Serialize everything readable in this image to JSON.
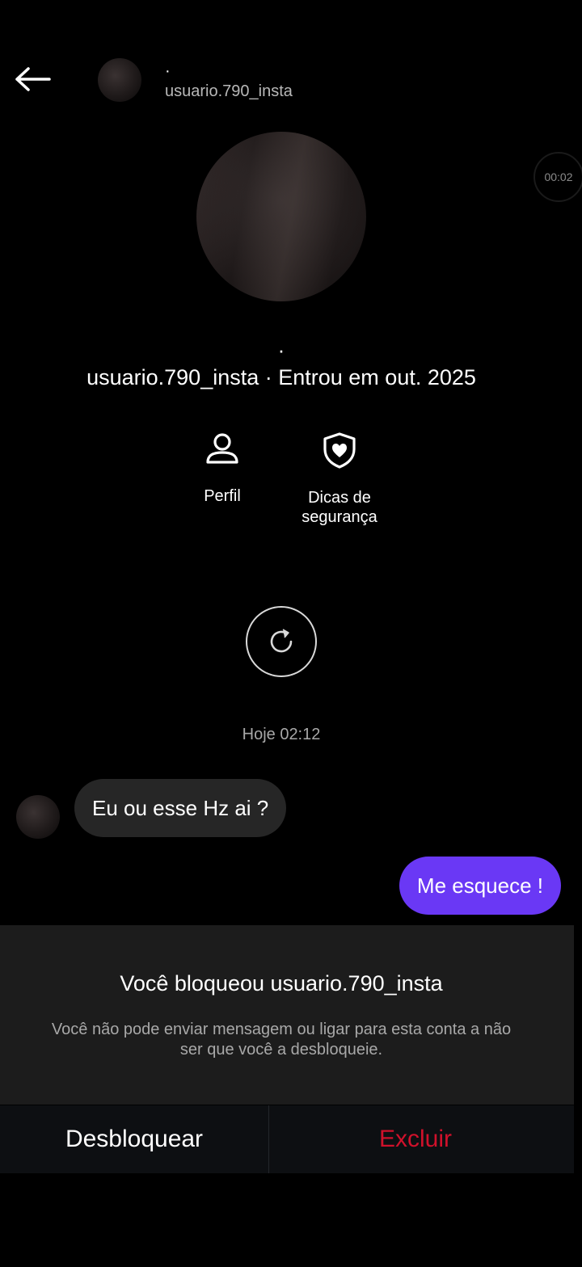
{
  "header": {
    "name": "·",
    "username": "usuario.790_insta",
    "back_icon": "arrow-left-icon"
  },
  "timer": {
    "label": "00:02"
  },
  "profile": {
    "name": "·",
    "info": "usuario.790_insta · Entrou em out. 2025"
  },
  "actions": [
    {
      "label": "Perfil",
      "icon": "person-icon"
    },
    {
      "label_line1": "Dicas de",
      "label_line2": "segurança",
      "icon": "shield-heart-icon"
    }
  ],
  "refresh": {
    "icon": "refresh-icon"
  },
  "timestamp": "Hoje 02:12",
  "messages": [
    {
      "direction": "incoming",
      "text": "Eu ou esse Hz ai ?"
    },
    {
      "direction": "outgoing",
      "text": "Me esquece !"
    }
  ],
  "blocked": {
    "title": "Você bloqueou usuario.790_insta",
    "description": "Você não pode enviar mensagem ou ligar para esta conta a não ser que você a desbloqueie.",
    "unblock_label": "Desbloquear",
    "delete_label": "Excluir"
  },
  "colors": {
    "outgoing_bubble": "#6a38f5",
    "incoming_bubble": "#262626",
    "delete": "#d0112b",
    "background": "#000000"
  }
}
